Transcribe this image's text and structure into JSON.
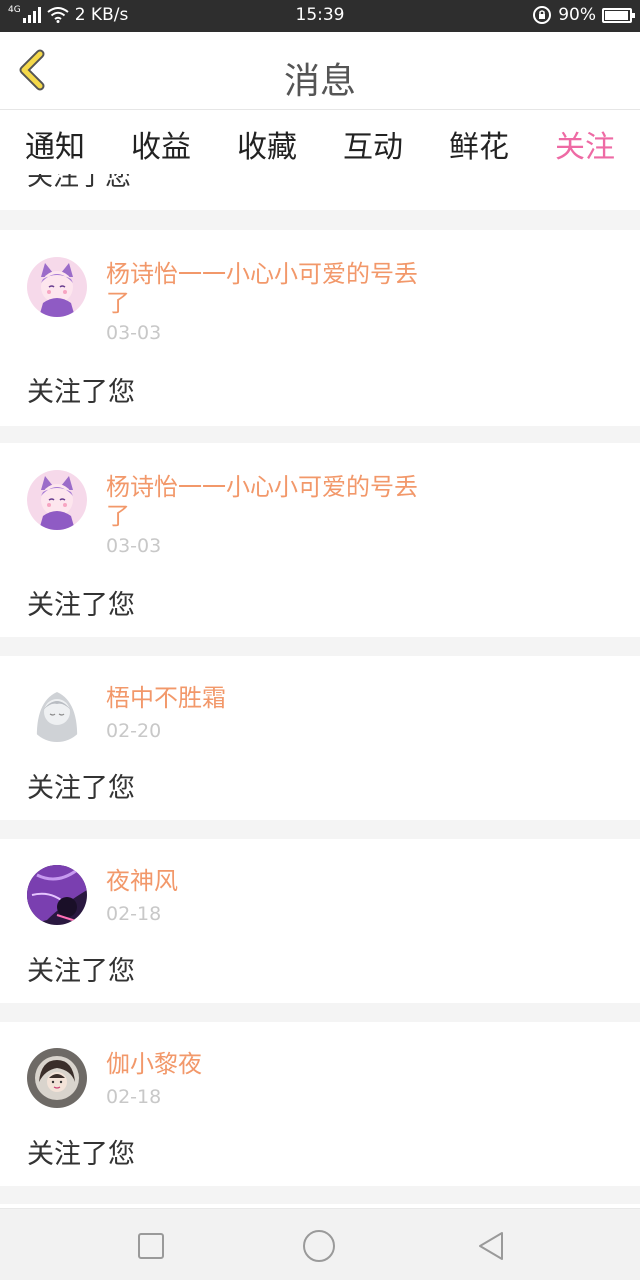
{
  "status_bar": {
    "network_tag": "4G",
    "speed": "2 KB/s",
    "time": "15:39",
    "battery": "90%",
    "battery_level": 0.9
  },
  "header": {
    "title": "消息",
    "back_icon": "chevron-left-icon"
  },
  "tabs": [
    {
      "label": "通知",
      "active": false
    },
    {
      "label": "收益",
      "active": false
    },
    {
      "label": "收藏",
      "active": false
    },
    {
      "label": "互动",
      "active": false
    },
    {
      "label": "鲜花",
      "active": false
    },
    {
      "label": "关注",
      "active": true
    }
  ],
  "partial_item_text": "关注了您",
  "notifications": [
    {
      "name": "杨诗怡一一小心小可爱的号丢了",
      "date": "03-03",
      "message": "关注了您",
      "avatar": "avatar-purple-cat"
    },
    {
      "name": "杨诗怡一一小心小可爱的号丢了",
      "date": "03-03",
      "message": "关注了您",
      "avatar": "avatar-purple-cat"
    },
    {
      "name": "梧中不胜霜",
      "date": "02-20",
      "message": "关注了您",
      "avatar": "avatar-silver-hair"
    },
    {
      "name": "夜神风",
      "date": "02-18",
      "message": "关注了您",
      "avatar": "avatar-dark-purple"
    },
    {
      "name": "伽小黎夜",
      "date": "02-18",
      "message": "关注了您",
      "avatar": "avatar-girl-photo"
    }
  ],
  "colors": {
    "accent_pink": "#ee6aa4",
    "name_orange": "#f2986a",
    "date_gray": "#c8c8c8"
  },
  "nav": [
    "square-icon",
    "circle-icon",
    "triangle-back-icon"
  ]
}
